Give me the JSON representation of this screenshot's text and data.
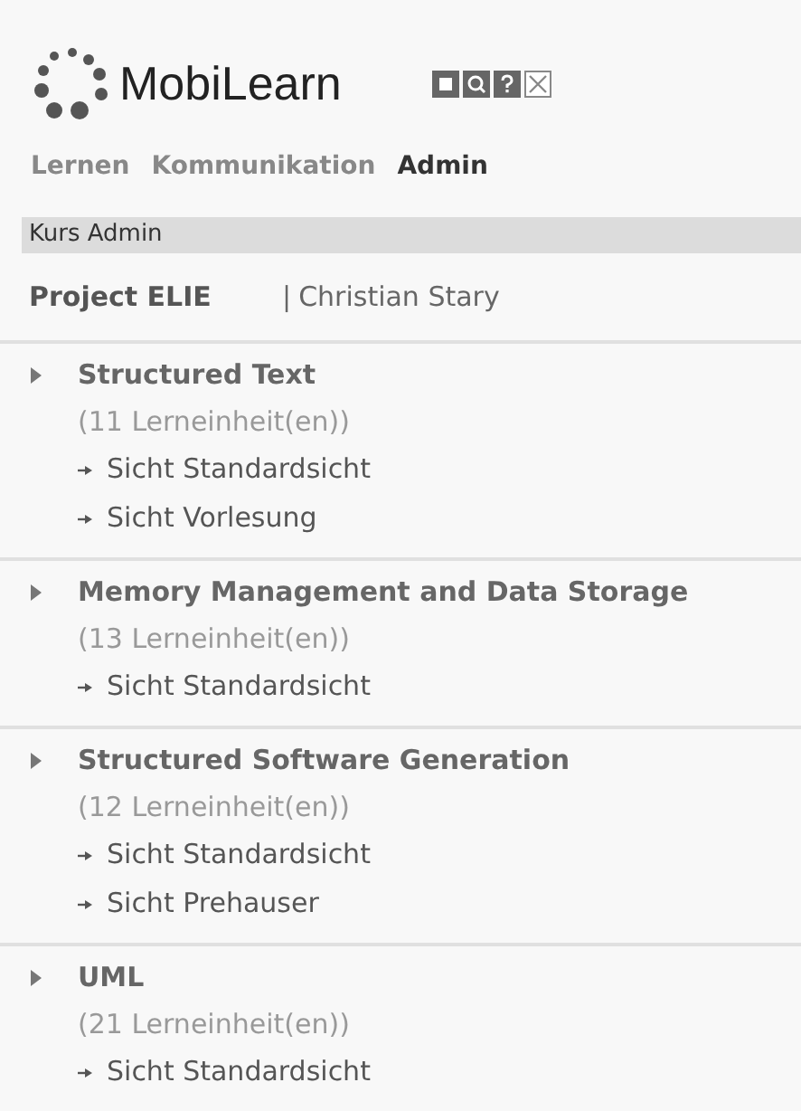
{
  "app": {
    "title": "MobiLearn"
  },
  "tabs": [
    {
      "label": "Lernen",
      "selected": false
    },
    {
      "label": "Kommunikation",
      "selected": false
    },
    {
      "label": "Admin",
      "selected": true
    }
  ],
  "section_bar": {
    "label": "Kurs Admin"
  },
  "project": {
    "name": "Project ELIE",
    "separator": "|",
    "author": "Christian Stary"
  },
  "courses": [
    {
      "title": "Structured Text",
      "count": "(11 Lerneinheit(en))",
      "views": [
        "Sicht Standardsicht",
        "Sicht Vorlesung"
      ]
    },
    {
      "title": "Memory Management and Data Storage",
      "count": "(13 Lerneinheit(en))",
      "views": [
        "Sicht Standardsicht"
      ]
    },
    {
      "title": "Structured Software Generation",
      "count": "(12 Lerneinheit(en))",
      "views": [
        "Sicht Standardsicht",
        "Sicht Prehauser"
      ]
    },
    {
      "title": "UML",
      "count": "(21 Lerneinheit(en))",
      "views": [
        "Sicht Standardsicht"
      ]
    }
  ]
}
